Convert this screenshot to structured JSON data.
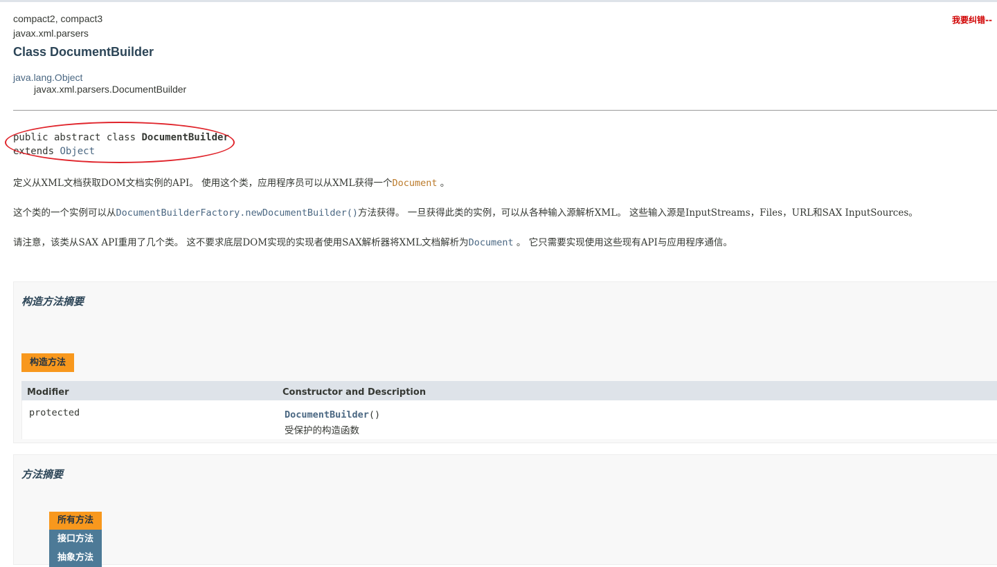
{
  "page": {
    "report_link": "我要纠错--",
    "profiles": "compact2, compact3",
    "package": "javax.xml.parsers",
    "class_title": "Class DocumentBuilder"
  },
  "inheritance": {
    "parent": "java.lang.Object",
    "child": "javax.xml.parsers.DocumentBuilder"
  },
  "declaration": {
    "prefix": "public abstract class ",
    "class_name": "DocumentBuilder",
    "extends_kw": "extends ",
    "extends_target": "Object"
  },
  "description": {
    "p1_text": "定义从XML文档获取DOM文档实例的API。 使用这个类，应用程序员可以从XML获得一个",
    "p1_link": "Document",
    "p1_end": " 。",
    "p2_text": "这个类的一个实例可以从",
    "p2_link": "DocumentBuilderFactory.newDocumentBuilder()",
    "p2_end": "方法获得。 一旦获得此类的实例，可以从各种输入源解析XML。 这些输入源是InputStreams，Files，URL和SAX InputSources。",
    "p3_text": "请注意，该类从SAX API重用了几个类。 这不要求底层DOM实现的实现者使用SAX解析器将XML文档解析为",
    "p3_code": "Document",
    "p3_end": " 。 它只需要实现使用这些现有API与应用程序通信。"
  },
  "constructor_summary": {
    "heading": "构造方法摘要",
    "tab": "构造方法",
    "col_modifier": "Modifier",
    "col_desc": "Constructor and Description",
    "rows": [
      {
        "modifier": "protected",
        "name": "DocumentBuilder",
        "params": "()",
        "description": "受保护的构造函数"
      }
    ]
  },
  "method_summary": {
    "heading": "方法摘要",
    "tabs": [
      "所有方法",
      "接口方法",
      "抽象方法"
    ]
  },
  "colors": {
    "accent_orange": "#f8981d",
    "tab_blue": "#4d7a97",
    "link_blue": "#4a6782",
    "annotation_red": "#e0242b"
  }
}
